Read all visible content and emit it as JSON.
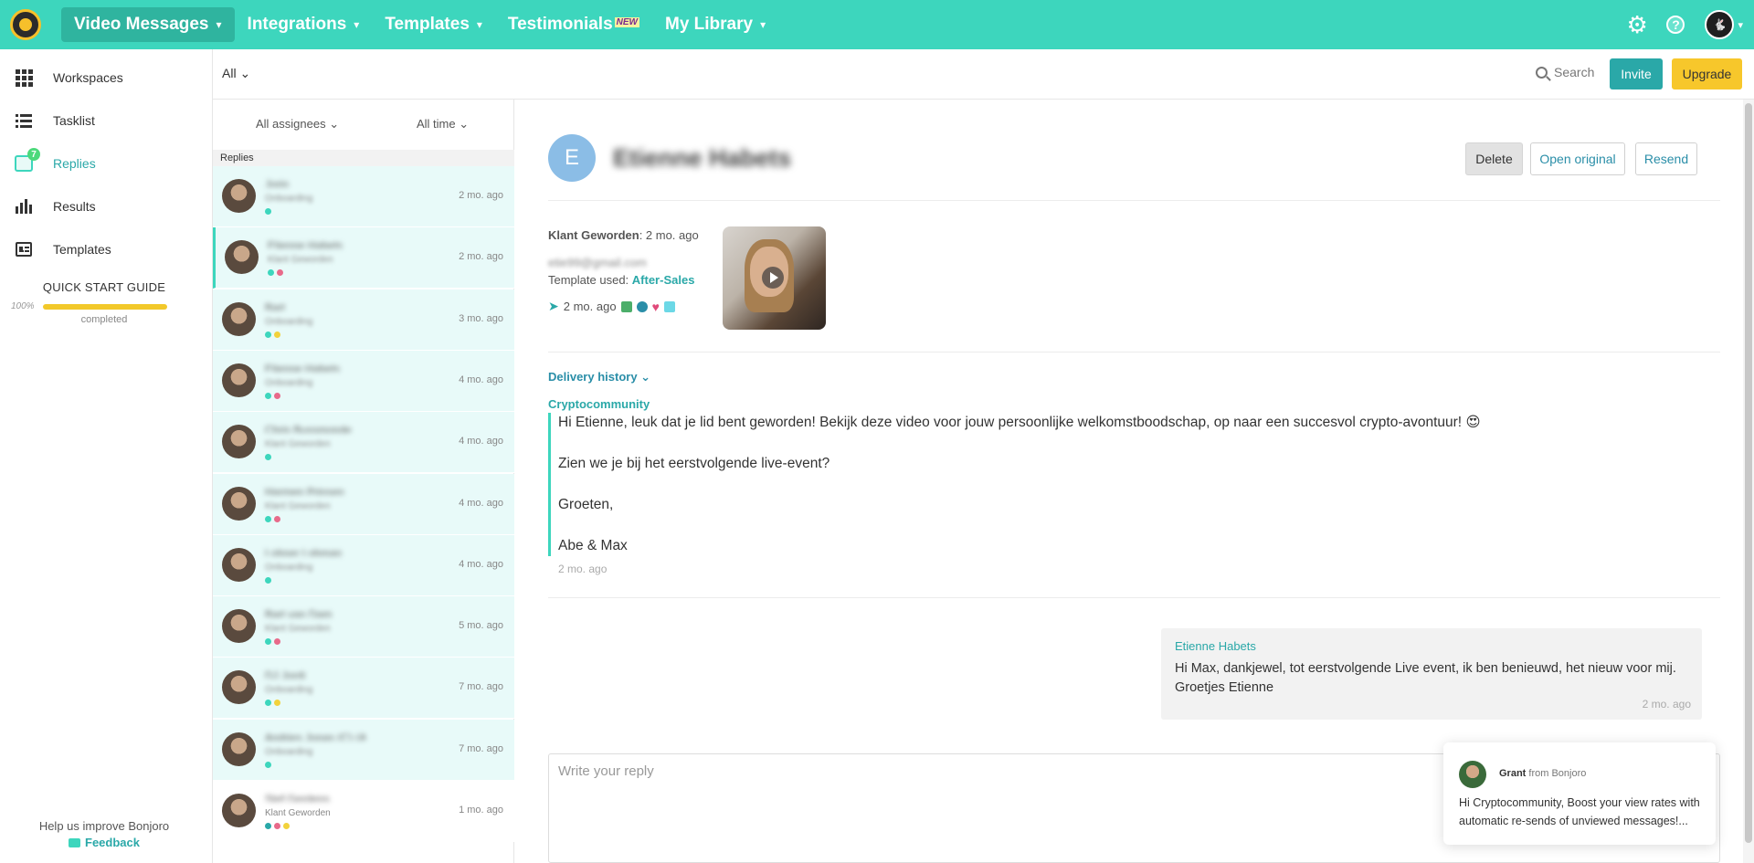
{
  "nav": {
    "items": [
      {
        "label": "Video Messages",
        "active": true,
        "chev": true
      },
      {
        "label": "Integrations",
        "active": false,
        "chev": true
      },
      {
        "label": "Templates",
        "active": false,
        "chev": true
      },
      {
        "label": "Testimonials",
        "active": false,
        "chev": false,
        "badge": "NEW"
      },
      {
        "label": "My Library",
        "active": false,
        "chev": true
      }
    ],
    "colors": {
      "bar": "#3dd6bd",
      "active": "#2fb49f"
    }
  },
  "toolbar": {
    "filter_all": "All",
    "search_label": "Search",
    "invite_label": "Invite",
    "upgrade_label": "Upgrade"
  },
  "sidebar": {
    "items": [
      {
        "label": "Workspaces",
        "icon": "grid-icon"
      },
      {
        "label": "Tasklist",
        "icon": "list-icon"
      },
      {
        "label": "Replies",
        "icon": "chat-icon",
        "badge": "7",
        "active": true
      },
      {
        "label": "Results",
        "icon": "bar-chart-icon"
      },
      {
        "label": "Templates",
        "icon": "template-icon"
      }
    ],
    "quick_start": {
      "title": "QUICK START GUIDE",
      "percent": "100%",
      "progress": 1.0,
      "status": "completed"
    },
    "improve_text": "Help us improve Bonjoro",
    "feedback_label": "Feedback"
  },
  "reply_list": {
    "filter_assignees": "All assignees",
    "filter_time": "All time",
    "header": "Replies",
    "rows": [
      {
        "name": "Jorin",
        "sub": "Onboarding",
        "time": "2 mo. ago",
        "dots": [
          "#3dd6bd"
        ]
      },
      {
        "name": "Etienne Habets",
        "sub": "Klant Geworden",
        "time": "2 mo. ago",
        "dots": [
          "#3dd6bd",
          "#e86a8a"
        ]
      },
      {
        "name": "Bart",
        "sub": "Onboarding",
        "time": "3 mo. ago",
        "dots": [
          "#3dd6bd",
          "#f2d23c"
        ]
      },
      {
        "name": "Etienne Habets",
        "sub": "Onboarding",
        "time": "4 mo. ago",
        "dots": [
          "#3dd6bd",
          "#e86a8a"
        ]
      },
      {
        "name": "Chris Bussmonde",
        "sub": "Klant Geworden",
        "time": "4 mo. ago",
        "dots": [
          "#3dd6bd"
        ]
      },
      {
        "name": "Harmen Prinsen",
        "sub": "Klant Geworden",
        "time": "4 mo. ago",
        "dots": [
          "#3dd6bd",
          "#e86a8a"
        ]
      },
      {
        "name": "Lohner Lohman",
        "sub": "Onboarding",
        "time": "4 mo. ago",
        "dots": [
          "#3dd6bd"
        ]
      },
      {
        "name": "Bart van Dam",
        "sub": "Klant Geworden",
        "time": "5 mo. ago",
        "dots": [
          "#3dd6bd",
          "#e86a8a"
        ]
      },
      {
        "name": "DJ Jordi",
        "sub": "Onboarding",
        "time": "7 mo. ago",
        "dots": [
          "#3dd6bd",
          "#f2d23c"
        ]
      },
      {
        "name": "Andries Jonas (C) (AHA)",
        "sub": "Onboarding",
        "time": "7 mo. ago",
        "dots": [
          "#3dd6bd"
        ]
      },
      {
        "name": "Stef Gerdens",
        "sub": "Klant Geworden",
        "time": "1 mo. ago",
        "dots": [
          "#2aa8a8",
          "#e86a8a",
          "#f2d23c"
        ]
      }
    ]
  },
  "detail": {
    "contact_initial": "E",
    "contact_name": "Etienne Habets",
    "delete_label": "Delete",
    "open_original_label": "Open original",
    "resend_label": "Resend",
    "campaign": "Klant Geworden",
    "campaign_time": ": 2 mo. ago",
    "email": "etie99@gmail.com",
    "template_prefix": "Template used: ",
    "template_name": "After-Sales",
    "sent_time": "2 mo. ago",
    "delivery_history": "Delivery history",
    "sender": "Cryptocommunity",
    "message": [
      "Hi Etienne, leuk dat je lid bent geworden! Bekijk deze video voor jouw persoonlijke welkomstboodschap, op naar een succesvol crypto-avontuur! 😍",
      "Zien we je bij het eerstvolgende live-event?",
      "Groeten,",
      "Abe & Max"
    ],
    "message_time": "2 mo. ago",
    "reply": {
      "name": "Etienne Habets",
      "text": "Hi Max, dankjewel, tot eerstvolgende Live event, ik ben benieuwd, het nieuw voor mij. Groetjes Etienne",
      "time": "2 mo. ago"
    },
    "reply_placeholder": "Write your reply"
  },
  "popup": {
    "from_name": "Grant",
    "from_suffix": " from Bonjoro",
    "text": "Hi Cryptocommunity, Boost your view rates with automatic re-sends of unviewed messages!..."
  }
}
